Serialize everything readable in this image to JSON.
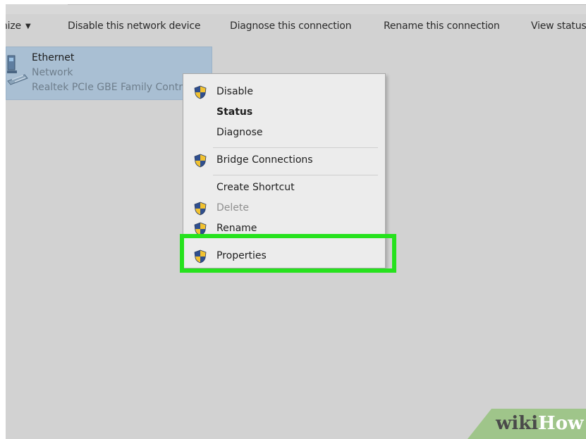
{
  "toolbar": {
    "organize_label": "nize",
    "disable_label": "Disable this network device",
    "diagnose_label": "Diagnose this connection",
    "rename_label": "Rename this connection",
    "view_status_label": "View status"
  },
  "adapter": {
    "name": "Ethernet",
    "type": "Network",
    "description": "Realtek PCIe GBE Family Contro"
  },
  "context_menu": {
    "disable": "Disable",
    "status": "Status",
    "diagnose": "Diagnose",
    "bridge": "Bridge Connections",
    "shortcut": "Create Shortcut",
    "delete": "Delete",
    "rename": "Rename",
    "properties": "Properties"
  },
  "watermark": {
    "wiki": "wiki",
    "how": "How"
  },
  "colors": {
    "highlight": "#26e21d",
    "selection": "#a9bfd3",
    "background": "#d2d2d2",
    "menu": "#ececec"
  },
  "icons": {
    "menu": "uac-shield-icon",
    "adapter": "network-adapter-icon",
    "organize": "caret-down-icon"
  }
}
